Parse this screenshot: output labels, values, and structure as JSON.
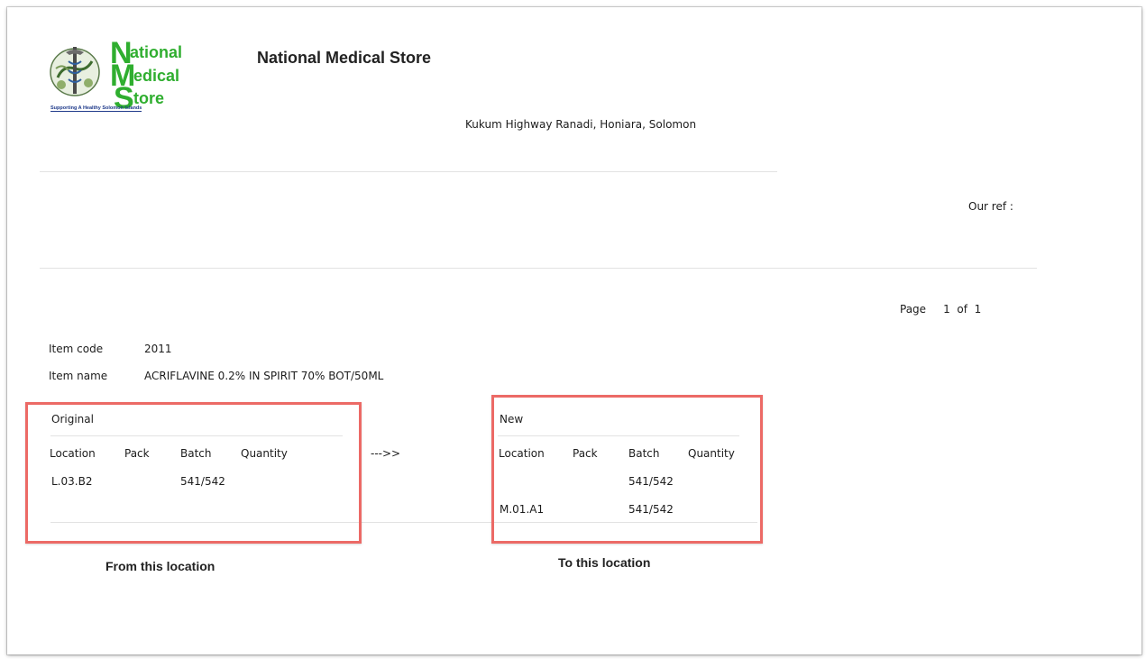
{
  "logo": {
    "line1": "ational",
    "line2": "edical",
    "line3": "tore",
    "letters": [
      "N",
      "M",
      "S"
    ],
    "tagline": "Supporting A Healthy Solomon Islands",
    "brand_green": "#2fae2f",
    "tagline_blue": "#1f3a8a"
  },
  "header": {
    "org_name": "National Medical Store",
    "address": "Kukum Highway Ranadi, Honiara, Solomon"
  },
  "reference": {
    "our_ref_label": "Our ref :"
  },
  "paging": {
    "page_label": "Page",
    "current": "1",
    "of_label": "of",
    "total": "1"
  },
  "item": {
    "code_label": "Item code",
    "code_value": "2011",
    "name_label": "Item name",
    "name_value": "ACRIFLAVINE 0.2% IN SPIRIT 70%  BOT/50ML"
  },
  "original": {
    "title": "Original",
    "columns": [
      "Location",
      "Pack",
      "Batch",
      "Quantity"
    ],
    "rows": [
      {
        "location": "L.03.B2",
        "pack": "",
        "batch": "541/542",
        "quantity": ""
      }
    ]
  },
  "arrow": "--->>",
  "new": {
    "title": "New",
    "columns": [
      "Location",
      "Pack",
      "Batch",
      "Quantity"
    ],
    "rows": [
      {
        "location": "",
        "pack": "",
        "batch": "541/542",
        "quantity": ""
      },
      {
        "location": "M.01.A1",
        "pack": "",
        "batch": "541/542",
        "quantity": ""
      }
    ]
  },
  "captions": {
    "from": "From this location",
    "to": "To this location"
  },
  "annotation_color": "#ec6a66"
}
